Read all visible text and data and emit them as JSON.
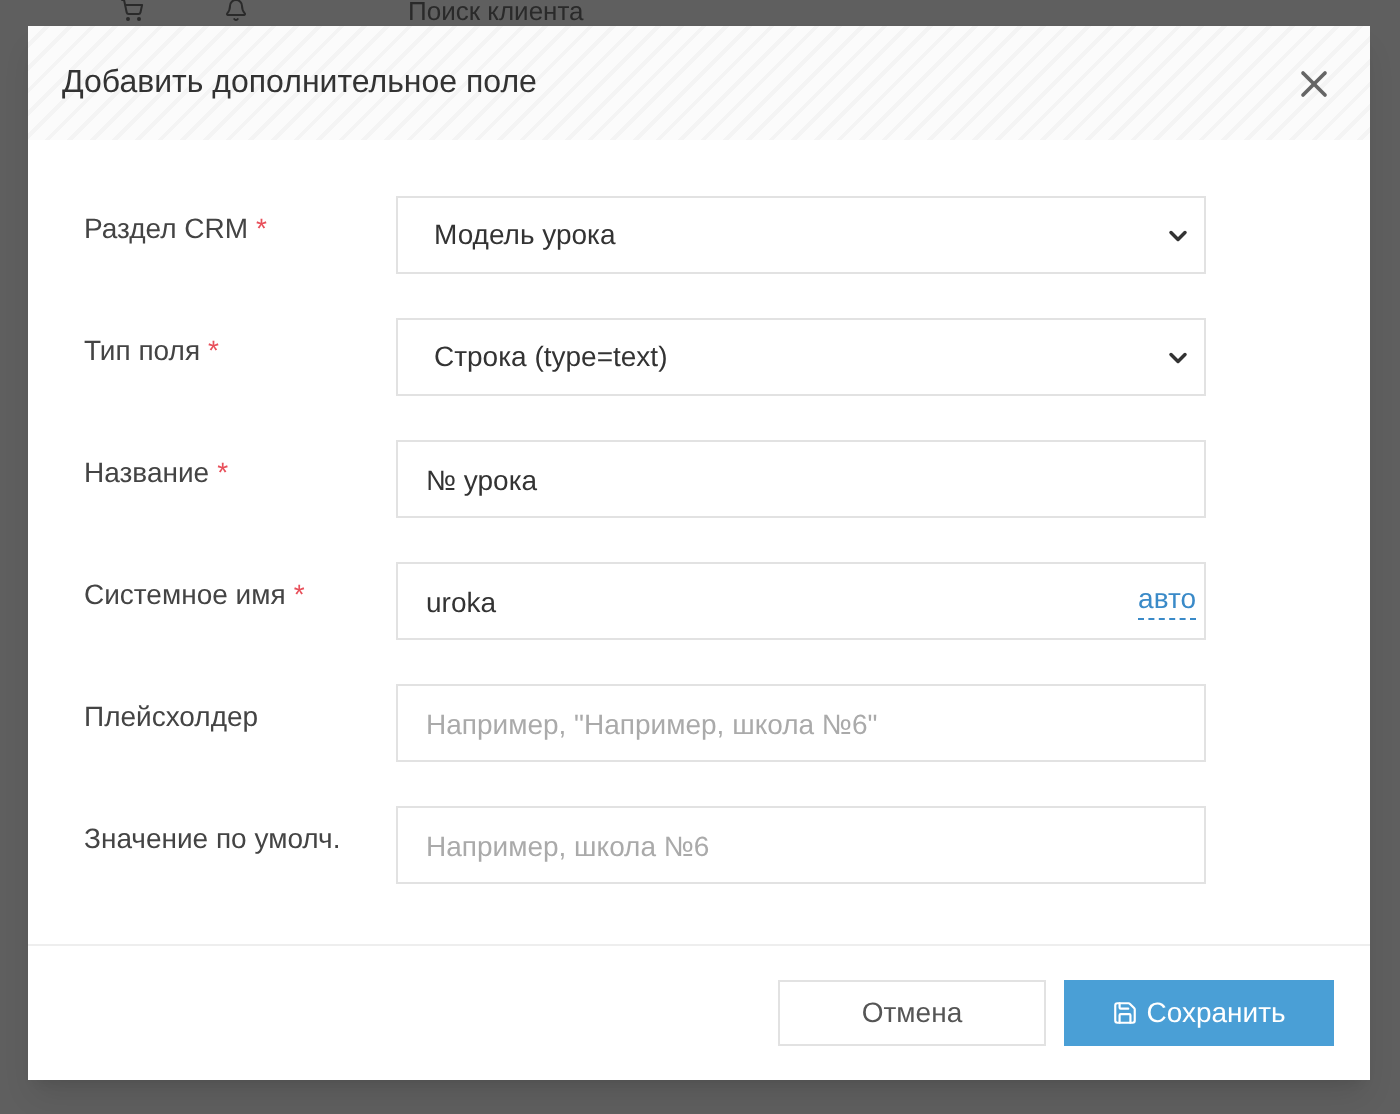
{
  "background": {
    "search_label": "Поиск клиента"
  },
  "dialog": {
    "title": "Добавить дополнительное поле",
    "required_mark": "*",
    "fields": [
      {
        "kind": "select",
        "label": "Раздел CRM",
        "required": true,
        "value": "Модель урока"
      },
      {
        "kind": "select",
        "label": "Тип поля",
        "required": true,
        "value": "Строка (type=text)"
      },
      {
        "kind": "input",
        "label": "Название",
        "required": true,
        "value": "№ урока"
      },
      {
        "kind": "input",
        "label": "Системное имя",
        "required": true,
        "value": "uroka",
        "link": "авто"
      },
      {
        "kind": "input",
        "label": "Плейсхолдер",
        "required": false,
        "placeholder": "Например, \"Например, школа №6\""
      },
      {
        "kind": "input",
        "label": "Значение по умолч.",
        "required": false,
        "placeholder": "Например, школа №6"
      }
    ],
    "buttons": {
      "cancel": "Отмена",
      "save": "Сохранить"
    }
  }
}
